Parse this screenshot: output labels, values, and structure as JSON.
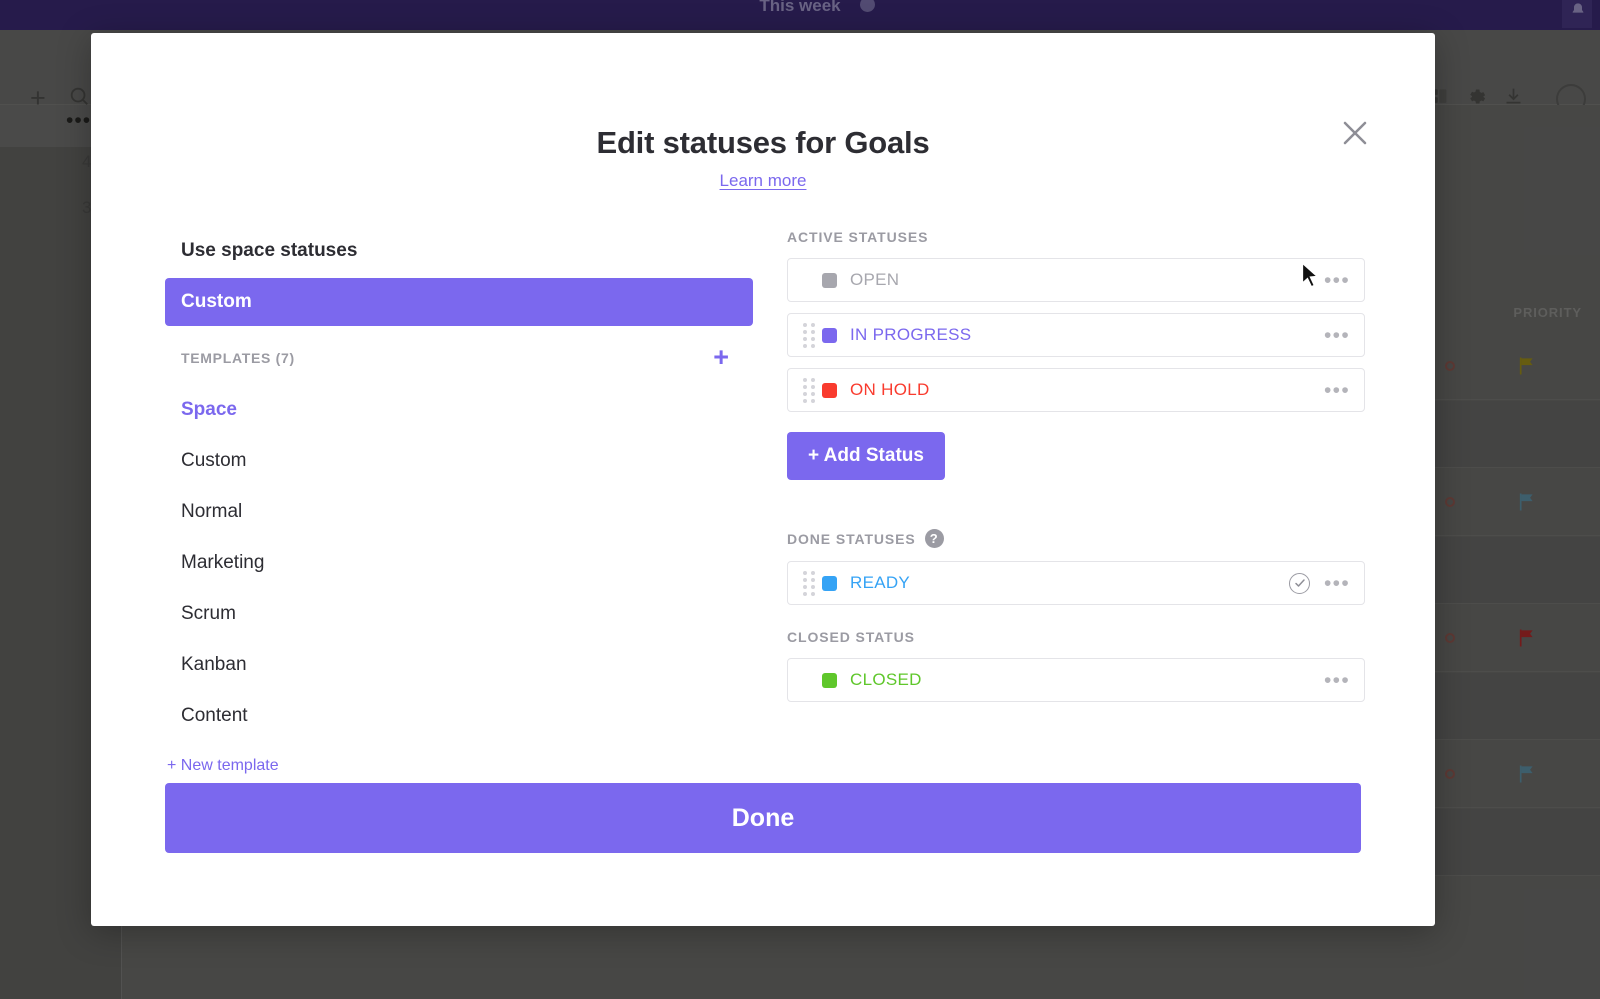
{
  "background": {
    "topbar": {
      "title": "This week",
      "info_icon": "info-icon",
      "bell_icon": "bell-icon"
    },
    "toolbar_icons": [
      "plus-icon",
      "search-icon",
      "grid-icon",
      "gear-icon",
      "download-icon",
      "avatar"
    ],
    "row_numbers": [
      "4",
      "3"
    ],
    "table": {
      "column_header": "PRIORITY"
    },
    "priority_flags": [
      "#8a7c0f",
      "#4f7f92",
      "#9e1f1f",
      "#4f7f92"
    ],
    "overflow_dots": "•••"
  },
  "modal": {
    "title": "Edit statuses for Goals",
    "learn_more": "Learn more",
    "close_icon": "close-icon",
    "left": {
      "use_space_statuses": "Use space statuses",
      "custom_selected": "Custom",
      "templates_label": "TEMPLATES (7)",
      "add_template_icon": "plus-icon",
      "templates": [
        {
          "label": "Space",
          "active": true
        },
        {
          "label": "Custom",
          "active": false
        },
        {
          "label": "Normal",
          "active": false
        },
        {
          "label": "Marketing",
          "active": false
        },
        {
          "label": "Scrum",
          "active": false
        },
        {
          "label": "Kanban",
          "active": false
        },
        {
          "label": "Content",
          "active": false
        }
      ],
      "new_template": "+ New template"
    },
    "right": {
      "active_label": "ACTIVE STATUSES",
      "active_statuses": [
        {
          "name": "OPEN",
          "color": "#a7a7ae",
          "draggable": false
        },
        {
          "name": "IN PROGRESS",
          "color": "#7b68ee",
          "draggable": true
        },
        {
          "name": "ON HOLD",
          "color": "#f93b2e",
          "draggable": true
        }
      ],
      "add_status_label": "+ Add Status",
      "done_label": "DONE STATUSES",
      "done_help_icon": "help-icon",
      "done_help_glyph": "?",
      "done_statuses": [
        {
          "name": "READY",
          "color": "#35a3f5",
          "draggable": true,
          "check": true
        }
      ],
      "closed_label": "CLOSED STATUS",
      "closed_statuses": [
        {
          "name": "CLOSED",
          "color": "#5fc72b",
          "draggable": false
        }
      ],
      "row_menu_icon": "ellipsis-icon",
      "row_menu_glyph": "•••"
    },
    "footer": {
      "done_label": "Done"
    }
  },
  "colors": {
    "accent": "#7b68ee",
    "topbar": "#2e1f63",
    "muted_text": "#9b9ba3"
  }
}
